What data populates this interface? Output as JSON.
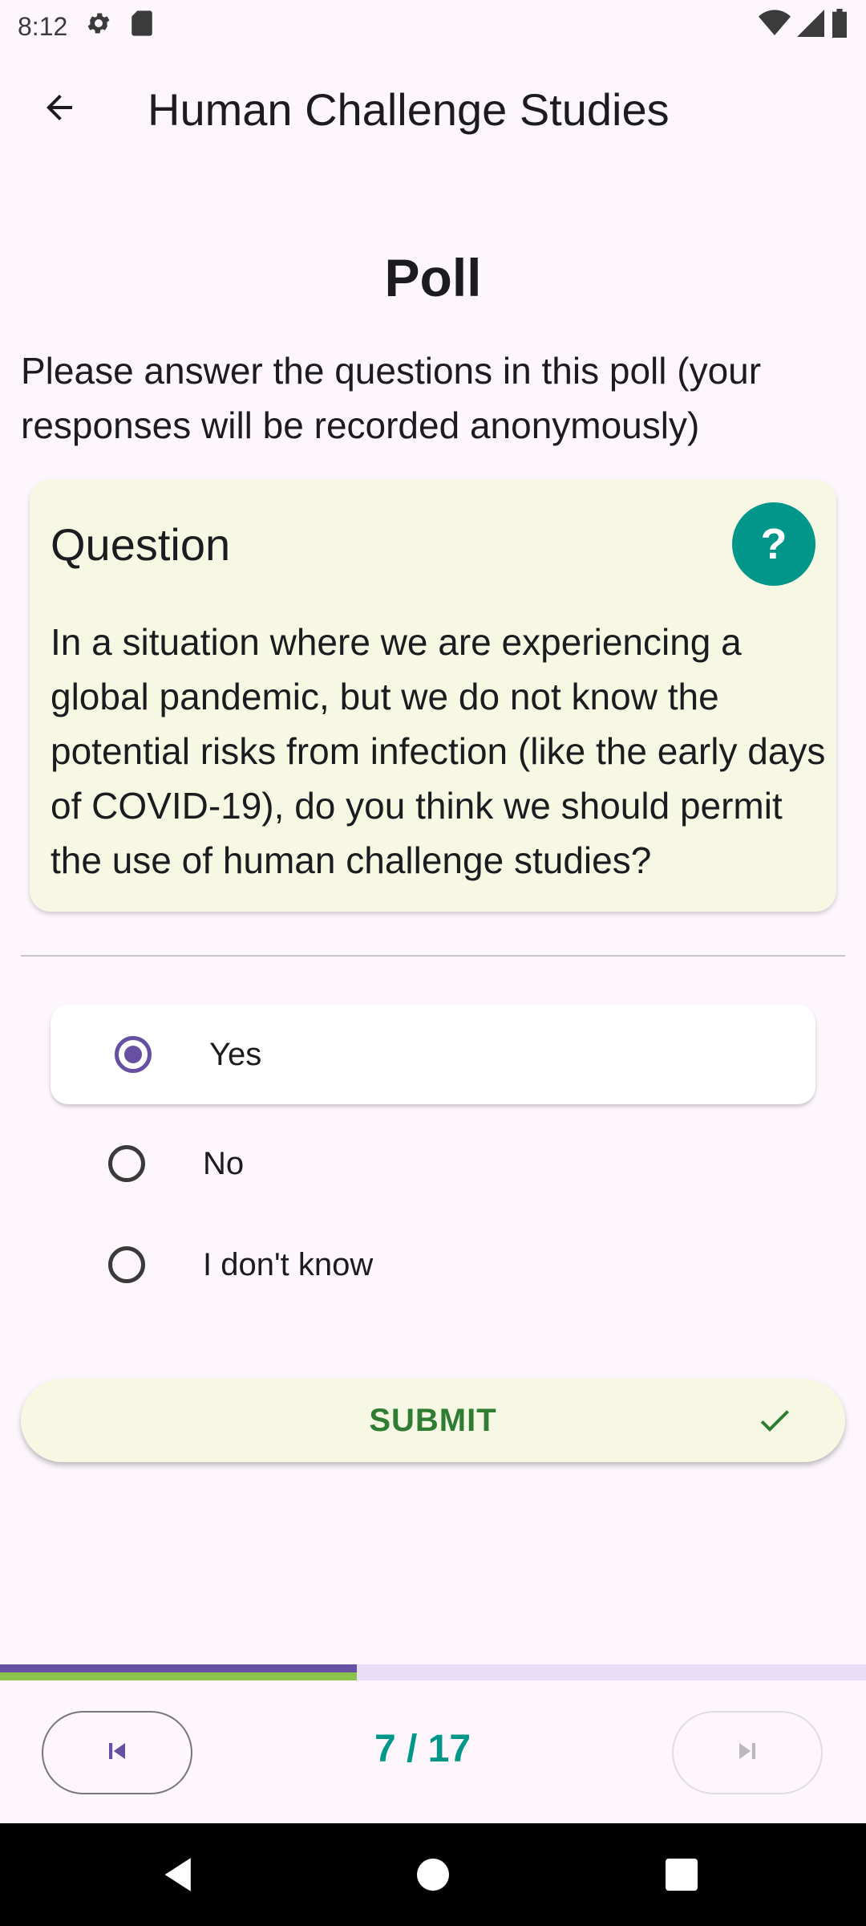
{
  "status_bar": {
    "time": "8:12"
  },
  "app_bar": {
    "title": "Human Challenge Studies"
  },
  "poll": {
    "title": "Poll",
    "description": "Please answer the questions in this poll (your responses will be recorded anonymously)"
  },
  "question_card": {
    "heading": "Question",
    "help_label": "?",
    "text": "In a situation where we are experiencing a global pandemic, but we do not know the potential risks from infection (like the early days of COVID-19), do you think we should permit the use of human challenge studies?"
  },
  "options": [
    {
      "label": "Yes",
      "selected": true
    },
    {
      "label": "No",
      "selected": false
    },
    {
      "label": "I don't know",
      "selected": false
    }
  ],
  "submit": {
    "label": "SUBMIT"
  },
  "pagination": {
    "current": 7,
    "total": 17,
    "display": "7 / 17",
    "progress_fraction": 0.412
  },
  "colors": {
    "accent_purple": "#6750A4",
    "teal": "#00968A",
    "green": "#2E7D32",
    "card_bg": "#F7F8E4"
  },
  "icons": {
    "back": "arrow-left-icon",
    "help": "question-mark-icon",
    "submit": "check-icon",
    "prev": "skip-previous-icon",
    "next": "skip-next-icon"
  }
}
